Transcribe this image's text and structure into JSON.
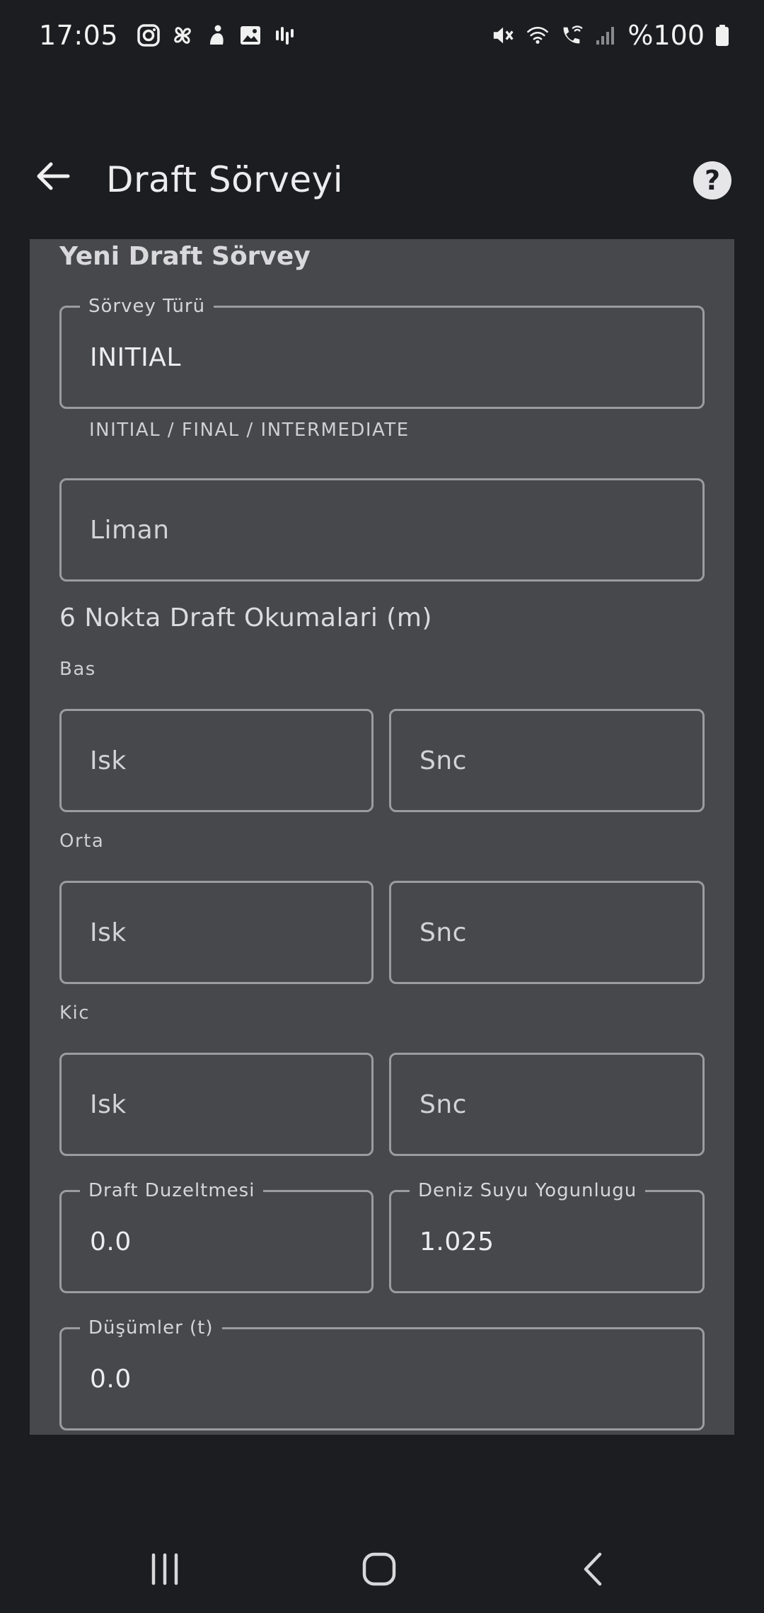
{
  "status_bar": {
    "time": "17:05",
    "battery": "%100",
    "left_icons": [
      "instagram-icon",
      "pinwheel-icon",
      "person-icon",
      "image-icon",
      "equalizer-icon"
    ],
    "right_icons": [
      "mute-icon",
      "wifi-icon",
      "wifi-call-icon",
      "signal-icon",
      "battery-icon"
    ]
  },
  "app_bar": {
    "title": "Draft Sörveyi",
    "back_icon": "arrow-left-icon",
    "help_icon": "help-circle-icon"
  },
  "form": {
    "title": "Yeni Draft Sörvey",
    "survey_type": {
      "label": "Sörvey Türü",
      "value": "INITIAL",
      "helper": "INITIAL / FINAL / INTERMEDIATE"
    },
    "port": {
      "placeholder": "Liman"
    },
    "readings_title": "6 Nokta Draft Okumalari (m)",
    "groups": [
      {
        "label": "Bas",
        "port_placeholder": "Isk",
        "starboard_placeholder": "Snc"
      },
      {
        "label": "Orta",
        "port_placeholder": "Isk",
        "starboard_placeholder": "Snc"
      },
      {
        "label": "Kic",
        "port_placeholder": "Isk",
        "starboard_placeholder": "Snc"
      }
    ],
    "draft_correction": {
      "label": "Draft Duzeltmesi",
      "value": "0.0"
    },
    "seawater_density": {
      "label": "Deniz Suyu Yogunlugu",
      "value": "1.025"
    },
    "deductions": {
      "label": "Düşümler (t)",
      "value": "0.0"
    }
  },
  "colors": {
    "background": "#1c1d20",
    "card": "#47484c",
    "field_border": "#9b9ca1"
  }
}
